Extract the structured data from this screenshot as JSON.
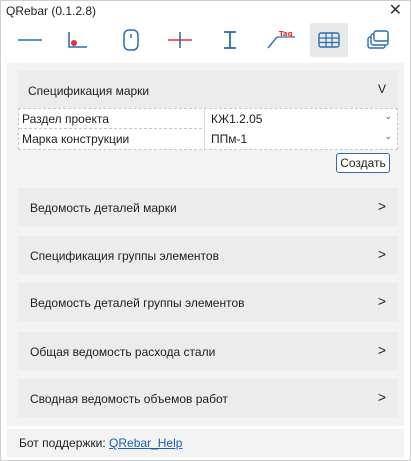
{
  "window": {
    "title": "QRebar (0.1.2.8)",
    "close_glyph": "✕"
  },
  "toolbar": [
    {
      "icon": "line-icon"
    },
    {
      "icon": "point-on-line-icon",
      "accent": "#e0303a"
    },
    {
      "icon": "mouse-icon"
    },
    {
      "icon": "crosshair-icon",
      "accent": "#e0303a"
    },
    {
      "icon": "beam-icon"
    },
    {
      "icon": "tag-icon",
      "text": "Tag",
      "accent": "#e0303a"
    },
    {
      "icon": "table-icon",
      "active": true
    },
    {
      "icon": "stack-icon"
    }
  ],
  "spec": {
    "header": "Спецификация марки",
    "toggle": "V",
    "fields": [
      {
        "label": "Раздел проекта",
        "value": "КЖ1.2.05"
      },
      {
        "label": "Марка конструкции",
        "value": "ППм-1"
      }
    ],
    "dropdown_glyph": "⌄",
    "create_label": "Создать"
  },
  "sections": [
    {
      "label": "Ведомость деталей марки",
      "chevron": ">"
    },
    {
      "label": "Спецификация группы элементов",
      "chevron": ">"
    },
    {
      "label": "Ведомость деталей группы элементов",
      "chevron": ">"
    },
    {
      "label": "Общая ведомость расхода стали",
      "chevron": ">"
    },
    {
      "label": "Сводная ведомость объемов работ",
      "chevron": ">"
    }
  ],
  "footer": {
    "text": "Бот поддержки:",
    "link": "QRebar_Help"
  },
  "colors": {
    "accent_red": "#e0303a",
    "icon_blue": "#2a6fb0",
    "link": "#1a5fb4"
  }
}
